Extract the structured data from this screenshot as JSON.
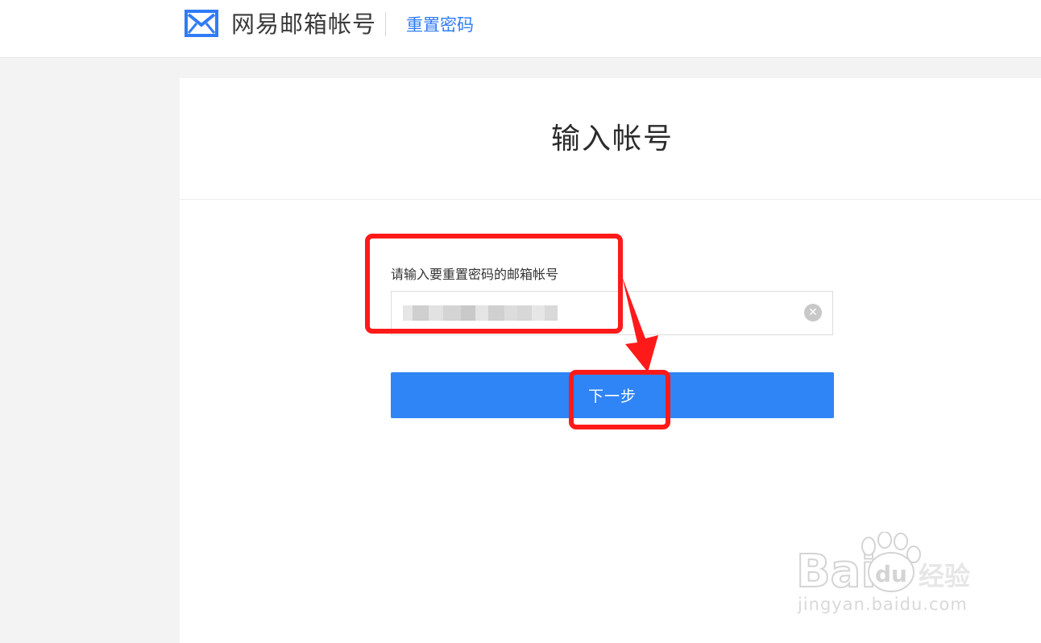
{
  "header": {
    "brand": "网易邮箱帐号",
    "subtitle": "重置密码"
  },
  "panel": {
    "title": "输入帐号",
    "field_label": "请输入要重置密码的邮箱帐号",
    "input_value": "",
    "clear_icon": "clear-icon",
    "next_label": "下一步"
  },
  "watermark": {
    "brand": "Baidu经验",
    "brand_cn": "经验",
    "url": "jingyan.baidu.com"
  },
  "colors": {
    "accent": "#2f84f6",
    "link": "#2f7cf6",
    "annotation": "#ff1a1a"
  }
}
